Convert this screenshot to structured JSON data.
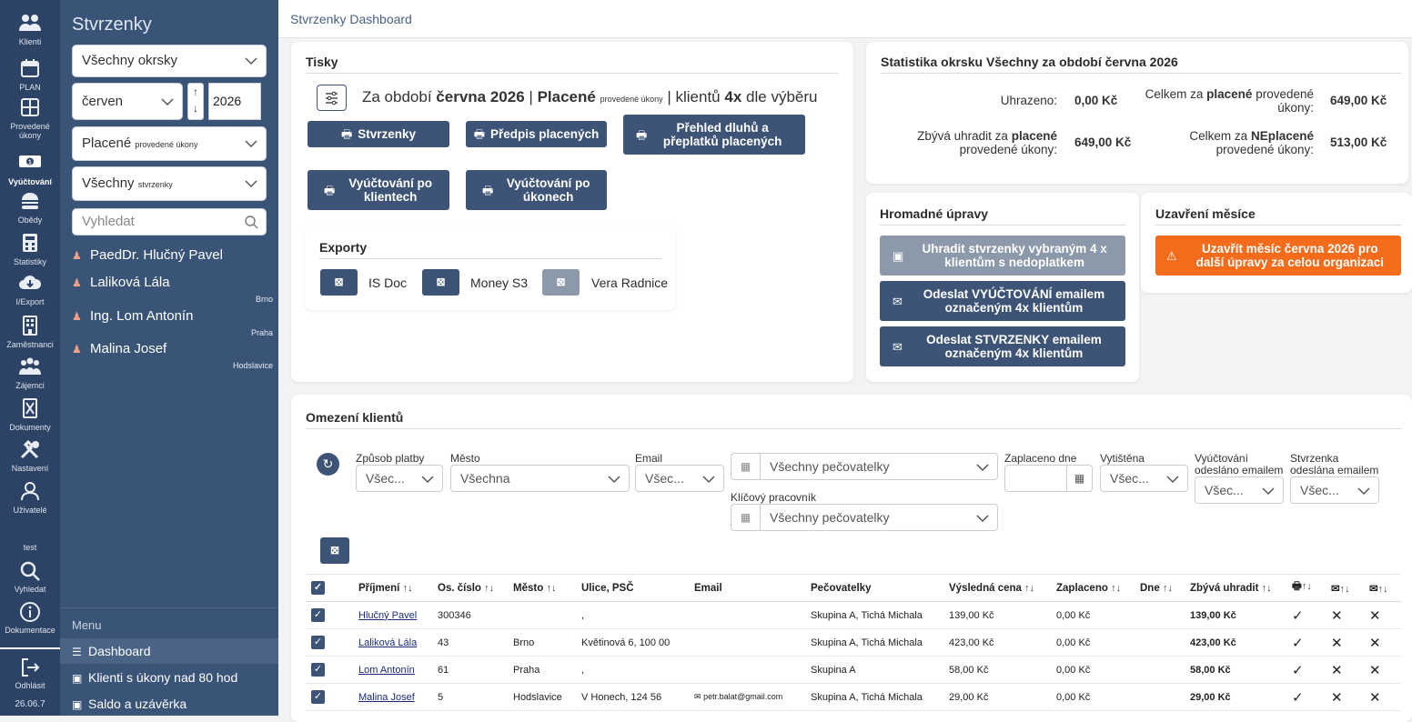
{
  "rail": {
    "items": [
      {
        "label": "Klienti",
        "icon": "users-icon"
      },
      {
        "label": "PLAN",
        "icon": "calendar-icon"
      },
      {
        "label": "Provedené úkony",
        "icon": "grid-icon"
      },
      {
        "label": "Vyúčtování",
        "icon": "money-icon"
      },
      {
        "label": "Obědy",
        "icon": "burger-icon"
      },
      {
        "label": "Statistiky",
        "icon": "calculator-icon"
      },
      {
        "label": "I/Export",
        "icon": "cloud-download-icon"
      },
      {
        "label": "Zaměstnanci",
        "icon": "building-icon"
      },
      {
        "label": "Zájemci",
        "icon": "group-icon"
      },
      {
        "label": "Dokumenty",
        "icon": "document-icon"
      },
      {
        "label": "Nastavení",
        "icon": "tools-icon"
      },
      {
        "label": "Uživatelé",
        "icon": "user-icon"
      }
    ],
    "user": "test",
    "search_label": "Vyhledat",
    "docs_label": "Dokumentace",
    "logout_label": "Odhlásit",
    "version": "26.06.7"
  },
  "sidebar": {
    "title": "Stvrzenky",
    "district": "Všechny okrsky",
    "month": "červen",
    "year": "2026",
    "paid_main": "Placené",
    "paid_small": "provedené úkony",
    "receipts_main": "Všechny",
    "receipts_small": "stvrzenky",
    "search_placeholder": "Vyhledat",
    "clients": [
      {
        "name": "PaedDr. Hlučný Pavel",
        "city": ""
      },
      {
        "name": "Laliková Lála",
        "city": "Brno"
      },
      {
        "name": "Ing. Lom Antonín",
        "city": "Praha"
      },
      {
        "name": "Malina Josef",
        "city": "Hodslavice"
      }
    ],
    "menu_header": "Menu",
    "menu": [
      {
        "label": "Dashboard"
      },
      {
        "label": "Klienti s úkony nad 80 hod"
      },
      {
        "label": "Saldo a uzávěrka"
      }
    ]
  },
  "topbar": {
    "title": "Stvrzenky Dashboard"
  },
  "tisky": {
    "title": "Tisky",
    "period_prefix": "Za období",
    "period": "června 2026",
    "sep1": "|",
    "paid": "Placené",
    "paid_small": "provedené úkony",
    "sep2": "| klientů",
    "count": "4x",
    "suffix": "dle výběru",
    "buttons": {
      "stvrzenky": "Stvrzenky",
      "predpis": "Předpis placených",
      "prehled": "Přehled dluhů a přeplatků placených",
      "vyuct_klienti": "Vyúčtování po klientech",
      "vyuct_ukony": "Vyúčtování po úkonech"
    },
    "exports_title": "Exporty",
    "exports": [
      "IS Doc",
      "Money S3",
      "Vera Radnice"
    ]
  },
  "stats": {
    "title": "Statistika okrsku Všechny za období června 2026",
    "uhrazeno_label": "Uhrazeno:",
    "uhrazeno": "0,00 Kč",
    "celkem_placene_pre": "Celkem za",
    "celkem_placene_bold": "placené",
    "celkem_placene_post": "provedené",
    "celkem_placene_post2": "úkony:",
    "celkem_placene": "649,00 Kč",
    "zbyva_pre": "Zbývá uhradit za",
    "zbyva_bold": "placené",
    "zbyva_post": "provedené úkony:",
    "zbyva": "649,00 Kč",
    "celkem_ne_pre": "Celkem za",
    "celkem_ne_bold": "NEplacené",
    "celkem_ne_post": "provedené úkony:",
    "celkem_ne": "513,00 Kč"
  },
  "hromadne": {
    "title": "Hromadné úpravy",
    "b1": "Uhradit stvrzenky vybraným 4 x klientům s nedoplatkem",
    "b2": "Odeslat VYÚČTOVÁNÍ emailem označeným 4x klientům",
    "b3": "Odeslat STVRZENKY emailem označeným 4x klientům"
  },
  "uzavreni": {
    "title": "Uzavření měsíce",
    "button": "Uzavřít měsíc června 2026 pro další úpravy za celou organizaci"
  },
  "omezeni": {
    "title": "Omezení klientů",
    "zpusob_label": "Způsob platby",
    "zpusob_value": "Všec...",
    "mesto_label": "Město",
    "mesto_value": "Všechna",
    "email_label": "Email",
    "email_value": "Všec...",
    "pecovatelky_value": "Všechny pečovatelky",
    "klicovy_label": "Klíčový pracovník",
    "klicovy_value": "Všechny pečovatelky",
    "zaplaceno_label": "Zaplaceno dne",
    "vytistena_label": "Vytištěna",
    "vytistena_value": "Všec...",
    "vyuct_label": "Vyúčtování odesláno emailem",
    "vyuct_value": "Všec...",
    "stvr_label": "Stvrzenka odeslána emailem",
    "stvr_value": "Všec..."
  },
  "table": {
    "headers": [
      "Příjmení",
      "Os. číslo",
      "Město",
      "Ulice, PSČ",
      "Email",
      "Pečovatelky",
      "Výsledná cena",
      "Zaplaceno",
      "Dne",
      "Zbývá uhradit"
    ],
    "rows": [
      {
        "name": "Hlučný Pavel",
        "os": "300346",
        "mesto": "",
        "ulice": ",",
        "email": "",
        "pec": "Skupina A, Tichá Michala",
        "cena": "139,00 Kč",
        "zapl": "0,00 Kč",
        "dne": "",
        "zbyva": "139,00 Kč"
      },
      {
        "name": "Laliková Lála",
        "os": "43",
        "mesto": "Brno",
        "ulice": "Květinová 6, 100 00",
        "email": "",
        "pec": "Skupina A, Tichá Michala",
        "cena": "423,00 Kč",
        "zapl": "0,00 Kč",
        "dne": "",
        "zbyva": "423,00 Kč"
      },
      {
        "name": "Lom Antonín",
        "os": "61",
        "mesto": "Praha",
        "ulice": ",",
        "email": "",
        "pec": "Skupina A",
        "cena": "58,00 Kč",
        "zapl": "0,00 Kč",
        "dne": "",
        "zbyva": "58,00 Kč"
      },
      {
        "name": "Malina Josef",
        "os": "5",
        "mesto": "Hodslavice",
        "ulice": "V Honech, 124 56",
        "email": "petr.balat@gmail.com",
        "pec": "Skupina A, Tichá Michala",
        "cena": "29,00 Kč",
        "zapl": "0,00 Kč",
        "dne": "",
        "zbyva": "29,00 Kč"
      }
    ]
  },
  "colors": {
    "rail": "#2d4366",
    "sidebar": "#3a5478",
    "button": "#3d5477",
    "orange": "#f26c1b"
  }
}
